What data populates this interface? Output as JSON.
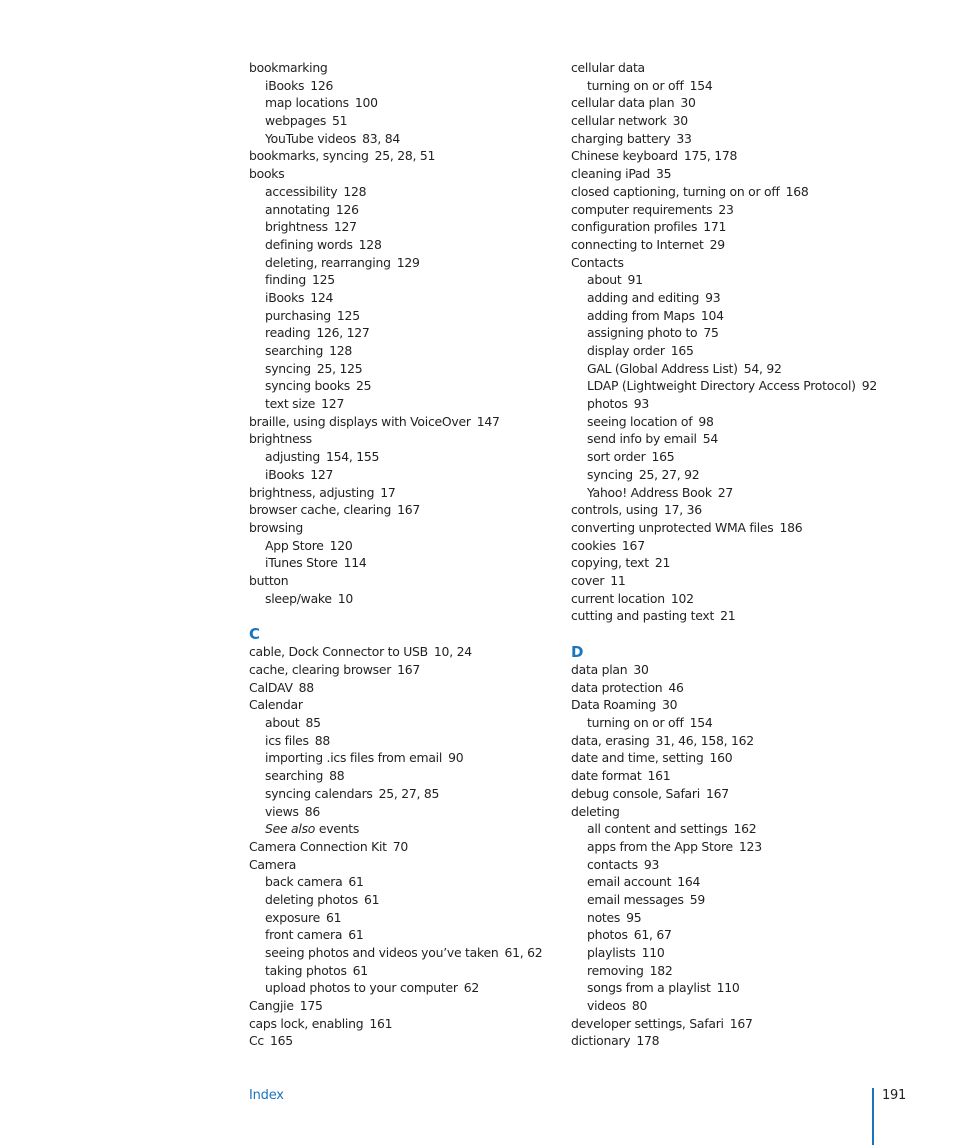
{
  "columns": [
    {
      "entries": [
        {
          "type": "main",
          "term": "bookmarking",
          "pages": ""
        },
        {
          "type": "sub",
          "term": "iBooks",
          "pages": "126"
        },
        {
          "type": "sub",
          "term": "map locations",
          "pages": "100"
        },
        {
          "type": "sub",
          "term": "webpages",
          "pages": "51"
        },
        {
          "type": "sub",
          "term": "YouTube videos",
          "pages": "83, 84"
        },
        {
          "type": "main",
          "term": "bookmarks, syncing",
          "pages": "25, 28, 51"
        },
        {
          "type": "main",
          "term": "books",
          "pages": ""
        },
        {
          "type": "sub",
          "term": "accessibility",
          "pages": "128"
        },
        {
          "type": "sub",
          "term": "annotating",
          "pages": "126"
        },
        {
          "type": "sub",
          "term": "brightness",
          "pages": "127"
        },
        {
          "type": "sub",
          "term": "defining words",
          "pages": "128"
        },
        {
          "type": "sub",
          "term": "deleting, rearranging",
          "pages": "129"
        },
        {
          "type": "sub",
          "term": "finding",
          "pages": "125"
        },
        {
          "type": "sub",
          "term": "iBooks",
          "pages": "124"
        },
        {
          "type": "sub",
          "term": "purchasing",
          "pages": "125"
        },
        {
          "type": "sub",
          "term": "reading",
          "pages": "126, 127"
        },
        {
          "type": "sub",
          "term": "searching",
          "pages": "128"
        },
        {
          "type": "sub",
          "term": "syncing",
          "pages": "25, 125"
        },
        {
          "type": "sub",
          "term": "syncing books",
          "pages": "25"
        },
        {
          "type": "sub",
          "term": "text size",
          "pages": "127"
        },
        {
          "type": "main",
          "term": "braille, using displays with VoiceOver",
          "pages": "147"
        },
        {
          "type": "main",
          "term": "brightness",
          "pages": ""
        },
        {
          "type": "sub",
          "term": "adjusting",
          "pages": "154, 155"
        },
        {
          "type": "sub",
          "term": "iBooks",
          "pages": "127"
        },
        {
          "type": "main",
          "term": "brightness, adjusting",
          "pages": "17"
        },
        {
          "type": "main",
          "term": "browser cache, clearing",
          "pages": "167"
        },
        {
          "type": "main",
          "term": "browsing",
          "pages": ""
        },
        {
          "type": "sub",
          "term": "App Store",
          "pages": "120"
        },
        {
          "type": "sub",
          "term": "iTunes Store",
          "pages": "114"
        },
        {
          "type": "main",
          "term": "button",
          "pages": ""
        },
        {
          "type": "sub",
          "term": "sleep/wake",
          "pages": "10"
        },
        {
          "type": "letter",
          "term": "C",
          "pages": ""
        },
        {
          "type": "main",
          "term": "cable, Dock Connector to USB",
          "pages": "10, 24"
        },
        {
          "type": "main",
          "term": "cache, clearing browser",
          "pages": "167"
        },
        {
          "type": "main",
          "term": "CalDAV",
          "pages": "88"
        },
        {
          "type": "main",
          "term": "Calendar",
          "pages": ""
        },
        {
          "type": "sub",
          "term": "about",
          "pages": "85"
        },
        {
          "type": "sub",
          "term": "ics files",
          "pages": "88"
        },
        {
          "type": "sub",
          "term": "importing .ics files from email",
          "pages": "90"
        },
        {
          "type": "sub",
          "term": "searching",
          "pages": "88"
        },
        {
          "type": "sub",
          "term": "syncing calendars",
          "pages": "25, 27, 85"
        },
        {
          "type": "sub",
          "term": "views",
          "pages": "86"
        },
        {
          "type": "seealso",
          "term": "events",
          "prefix": "See also",
          "pages": ""
        },
        {
          "type": "main",
          "term": "Camera Connection Kit",
          "pages": "70"
        },
        {
          "type": "main",
          "term": "Camera",
          "pages": ""
        },
        {
          "type": "sub",
          "term": "back camera",
          "pages": "61"
        },
        {
          "type": "sub",
          "term": "deleting photos",
          "pages": "61"
        },
        {
          "type": "sub",
          "term": "exposure",
          "pages": "61"
        },
        {
          "type": "sub",
          "term": "front camera",
          "pages": "61"
        },
        {
          "type": "sub",
          "term": "seeing photos and videos you’ve taken",
          "pages": "61, 62"
        },
        {
          "type": "sub",
          "term": "taking photos",
          "pages": "61"
        },
        {
          "type": "sub",
          "term": "upload photos to your computer",
          "pages": "62"
        },
        {
          "type": "main",
          "term": "Cangjie",
          "pages": "175"
        },
        {
          "type": "main",
          "term": "caps lock, enabling",
          "pages": "161"
        },
        {
          "type": "main",
          "term": "Cc",
          "pages": "165"
        }
      ]
    },
    {
      "entries": [
        {
          "type": "main",
          "term": "cellular data",
          "pages": ""
        },
        {
          "type": "sub",
          "term": "turning on or off",
          "pages": "154"
        },
        {
          "type": "main",
          "term": "cellular data plan",
          "pages": "30"
        },
        {
          "type": "main",
          "term": "cellular network",
          "pages": "30"
        },
        {
          "type": "main",
          "term": "charging battery",
          "pages": "33"
        },
        {
          "type": "main",
          "term": "Chinese keyboard",
          "pages": "175, 178"
        },
        {
          "type": "main",
          "term": "cleaning iPad",
          "pages": "35"
        },
        {
          "type": "main",
          "term": "closed captioning, turning on or off",
          "pages": "168"
        },
        {
          "type": "main",
          "term": "computer requirements",
          "pages": "23"
        },
        {
          "type": "main",
          "term": "configuration profiles",
          "pages": "171"
        },
        {
          "type": "main",
          "term": "connecting to Internet",
          "pages": "29"
        },
        {
          "type": "main",
          "term": "Contacts",
          "pages": ""
        },
        {
          "type": "sub",
          "term": "about",
          "pages": "91"
        },
        {
          "type": "sub",
          "term": "adding and editing",
          "pages": "93"
        },
        {
          "type": "sub",
          "term": "adding from Maps",
          "pages": "104"
        },
        {
          "type": "sub",
          "term": "assigning photo to",
          "pages": "75"
        },
        {
          "type": "sub",
          "term": "display order",
          "pages": "165"
        },
        {
          "type": "sub",
          "term": "GAL (Global Address List)",
          "pages": "54, 92"
        },
        {
          "type": "sub",
          "term": "LDAP (Lightweight Directory Access Protocol)",
          "pages": "92"
        },
        {
          "type": "sub",
          "term": "photos",
          "pages": "93"
        },
        {
          "type": "sub",
          "term": "seeing location of",
          "pages": "98"
        },
        {
          "type": "sub",
          "term": "send info by email",
          "pages": "54"
        },
        {
          "type": "sub",
          "term": "sort order",
          "pages": "165"
        },
        {
          "type": "sub",
          "term": "syncing",
          "pages": "25, 27, 92"
        },
        {
          "type": "sub",
          "term": "Yahoo! Address Book",
          "pages": "27"
        },
        {
          "type": "main",
          "term": "controls, using",
          "pages": "17, 36"
        },
        {
          "type": "main",
          "term": "converting unprotected WMA files",
          "pages": "186"
        },
        {
          "type": "main",
          "term": "cookies",
          "pages": "167"
        },
        {
          "type": "main",
          "term": "copying, text",
          "pages": "21"
        },
        {
          "type": "main",
          "term": "cover",
          "pages": "11"
        },
        {
          "type": "main",
          "term": "current location",
          "pages": "102"
        },
        {
          "type": "main",
          "term": "cutting and pasting text",
          "pages": "21"
        },
        {
          "type": "letter",
          "term": "D",
          "pages": ""
        },
        {
          "type": "main",
          "term": "data plan",
          "pages": "30"
        },
        {
          "type": "main",
          "term": "data protection",
          "pages": "46"
        },
        {
          "type": "main",
          "term": "Data Roaming",
          "pages": "30"
        },
        {
          "type": "sub",
          "term": "turning on or off",
          "pages": "154"
        },
        {
          "type": "main",
          "term": "data, erasing",
          "pages": "31, 46, 158, 162"
        },
        {
          "type": "main",
          "term": "date and time, setting",
          "pages": "160"
        },
        {
          "type": "main",
          "term": "date format",
          "pages": "161"
        },
        {
          "type": "main",
          "term": "debug console, Safari",
          "pages": "167"
        },
        {
          "type": "main",
          "term": "deleting",
          "pages": ""
        },
        {
          "type": "sub",
          "term": "all content and settings",
          "pages": "162"
        },
        {
          "type": "sub",
          "term": "apps from the App Store",
          "pages": "123"
        },
        {
          "type": "sub",
          "term": "contacts",
          "pages": "93"
        },
        {
          "type": "sub",
          "term": "email account",
          "pages": "164"
        },
        {
          "type": "sub",
          "term": "email messages",
          "pages": "59"
        },
        {
          "type": "sub",
          "term": "notes",
          "pages": "95"
        },
        {
          "type": "sub",
          "term": "photos",
          "pages": "61, 67"
        },
        {
          "type": "sub",
          "term": "playlists",
          "pages": "110"
        },
        {
          "type": "sub",
          "term": "removing",
          "pages": "182"
        },
        {
          "type": "sub",
          "term": "songs from a playlist",
          "pages": "110"
        },
        {
          "type": "sub",
          "term": "videos",
          "pages": "80"
        },
        {
          "type": "main",
          "term": "developer settings, Safari",
          "pages": "167"
        },
        {
          "type": "main",
          "term": "dictionary",
          "pages": "178"
        }
      ]
    }
  ],
  "footer": {
    "section_label": "Index",
    "page_number": "191"
  },
  "colors": {
    "accent": "#1b75bc",
    "text": "#231f20"
  }
}
